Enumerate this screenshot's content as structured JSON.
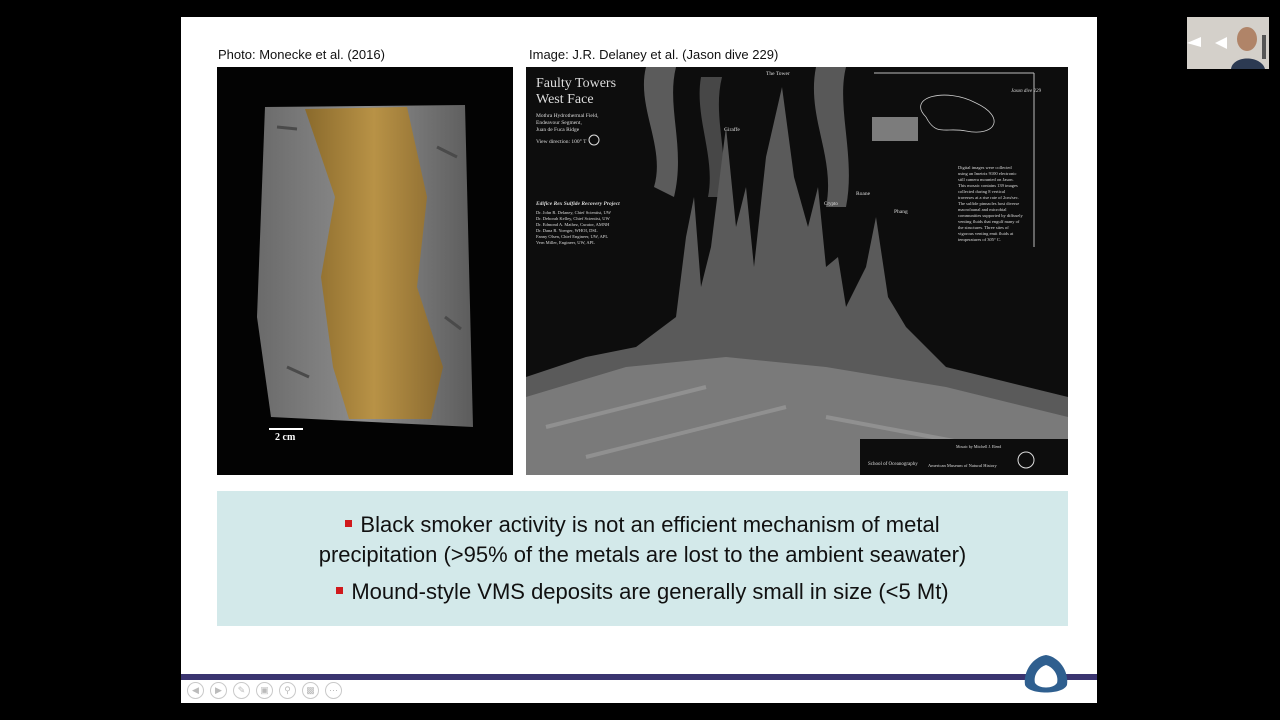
{
  "slide": {
    "caption_left": "Photo: Monecke et al. (2016)",
    "caption_right": "Image: J.R. Delaney et al. (Jason dive 229)",
    "left_photo": {
      "scale_label": "2 cm"
    },
    "right_image": {
      "title_line1": "Faulty Towers",
      "title_line2": "West Face",
      "location_lines": [
        "Mothra Hydrothermal Field,",
        "Endeavour Segment,",
        "Juan de Fuca Ridge"
      ],
      "view_direction": "View direction: 100° T",
      "project_title": "Edifice Rex Sulfide Recovery Project",
      "credits": [
        "Dr. John R. Delaney, Chief Scientist, UW",
        "Dr. Deborah Kelley, Chief Scientist, UW",
        "Dr. Edmond A. Mathez, Curator, AMNH",
        "Dr. Dana R. Yoerger, WHOI, DSL",
        "Fanny Olsen, Chief Engineer, UW, APL",
        "Vern Miller, Engineer, UW, APL"
      ],
      "tower_labels": {
        "tower": "The Tower",
        "giraffe": "Giraffe",
        "roane": "Roane",
        "phang": "Phang",
        "crypto": "Crypto"
      },
      "dive_label": "Jason dive 229",
      "description_lines": [
        "Digital images were collected",
        "using an Imetrix 9100 electronic",
        "still camera mounted on Jason.",
        "This mosaic contains 139 images",
        "collected during 8 vertical",
        "traverses at a rise rate of 2cm/sec.",
        "The sulfide pinnacles host diverse",
        "macrofaunal and microbial",
        "communities supported by diffusely",
        "venting fluids that engulf many of",
        "the structures. Three sites of",
        "vigorous venting emit fluids at",
        "temperatures of 305° C."
      ],
      "footer_mosaic": "Mosaic by Mitchell J. Elend",
      "footer_school": "School of Oceanography",
      "footer_museum": "American Museum of Natural History"
    },
    "bullets": [
      {
        "line1": "Black smoker activity is not an efficient mechanism of metal",
        "line2": "precipitation (>95% of the metals are lost to the ambient seawater)"
      },
      {
        "line1": "Mound-style VMS deposits are generally small in size (<5 Mt)"
      }
    ],
    "colors": {
      "bullet": "#d0191c",
      "callout_bg": "#d3e9ea",
      "bottom_bar": "#3a3470"
    }
  },
  "controls": [
    "back-icon",
    "forward-icon",
    "pen-icon",
    "slides-icon",
    "zoom-icon",
    "subtitle-icon",
    "more-icon"
  ]
}
